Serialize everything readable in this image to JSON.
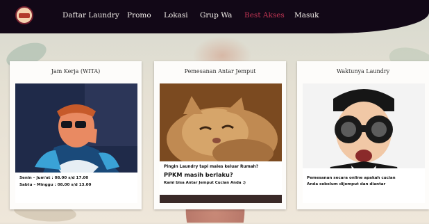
{
  "nav": {
    "items": [
      "Daftar Laundry",
      "Promo",
      "Lokasi",
      "Grup Wa",
      "Best Akses",
      "Masuk"
    ]
  },
  "colors": {
    "navbar_bg": "#120817",
    "nav_active": "#c23654",
    "card_bg": "#fdfcfa"
  },
  "cards": [
    {
      "title": "Jam Kerja (WITA)",
      "caption_lines": [
        "Senin – Jum'at : 08.00 s/d 17.00",
        "Sabtu – Minggu : 08.00 s/d 13.00"
      ]
    },
    {
      "title": "Pemesanan Antar Jemput",
      "caption_lines": [
        "Pingin Laundry tapi males keluar Rumah?",
        "PPKM masih berlaku?",
        "Kami bisa Antar Jemput Cucian Anda :)"
      ]
    },
    {
      "title": "Waktunya Laundry",
      "caption_lines": [
        "Pemesanan secara online apakah cucian",
        "Anda sebelum dijemput dan diantar"
      ]
    }
  ]
}
